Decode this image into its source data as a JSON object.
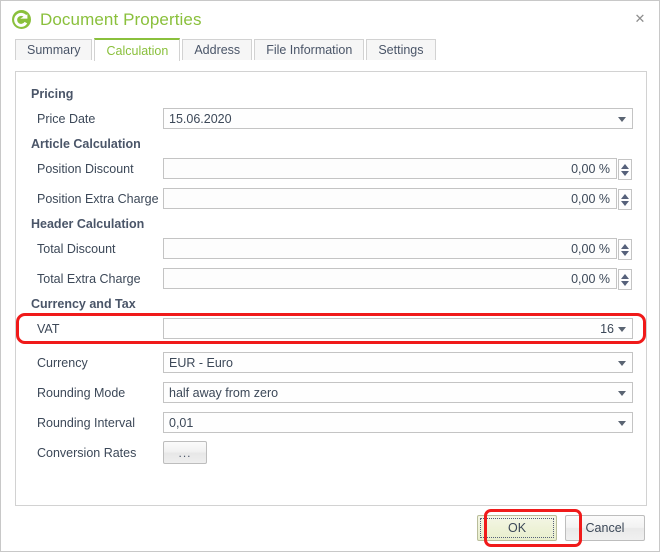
{
  "window": {
    "title": "Document Properties",
    "icon": "app-logo-e-icon",
    "close_label": "✕"
  },
  "tabs": [
    {
      "label": "Summary",
      "active": false
    },
    {
      "label": "Calculation",
      "active": true
    },
    {
      "label": "Address",
      "active": false
    },
    {
      "label": "File Information",
      "active": false
    },
    {
      "label": "Settings",
      "active": false
    }
  ],
  "sections": [
    {
      "title": "Pricing",
      "rows": [
        {
          "label": "Price Date",
          "value": "15.06.2020",
          "type": "combo",
          "align": "left"
        }
      ]
    },
    {
      "title": "Article Calculation",
      "rows": [
        {
          "label": "Position Discount",
          "value": "0,00 %",
          "type": "spinner",
          "align": "right"
        },
        {
          "label": "Position Extra Charge",
          "value": "0,00 %",
          "type": "spinner",
          "align": "right"
        }
      ]
    },
    {
      "title": "Header Calculation",
      "rows": [
        {
          "label": "Total Discount",
          "value": "0,00 %",
          "type": "spinner",
          "align": "right"
        },
        {
          "label": "Total Extra Charge",
          "value": "0,00 %",
          "type": "spinner",
          "align": "right"
        }
      ]
    },
    {
      "title": "Currency and Tax",
      "rows": [
        {
          "label": "VAT",
          "value": "16",
          "type": "combo",
          "align": "right",
          "highlighted": true
        },
        {
          "label": "Currency",
          "value": "EUR - Euro",
          "type": "combo",
          "align": "left"
        },
        {
          "label": "Rounding Mode",
          "value": "half away from zero",
          "type": "combo",
          "align": "left"
        },
        {
          "label": "Rounding Interval",
          "value": "0,01",
          "type": "combo",
          "align": "left"
        },
        {
          "label": "Conversion Rates",
          "value": "...",
          "type": "button",
          "align": "left"
        }
      ]
    }
  ],
  "footer": {
    "ok_label": "OK",
    "cancel_label": "Cancel"
  },
  "colors": {
    "accent_green": "#8ac03c",
    "highlight_red": "#f01a1a",
    "label_text": "#3c4858",
    "section_text": "#4a5568",
    "field_border": "#c4c4c4"
  }
}
